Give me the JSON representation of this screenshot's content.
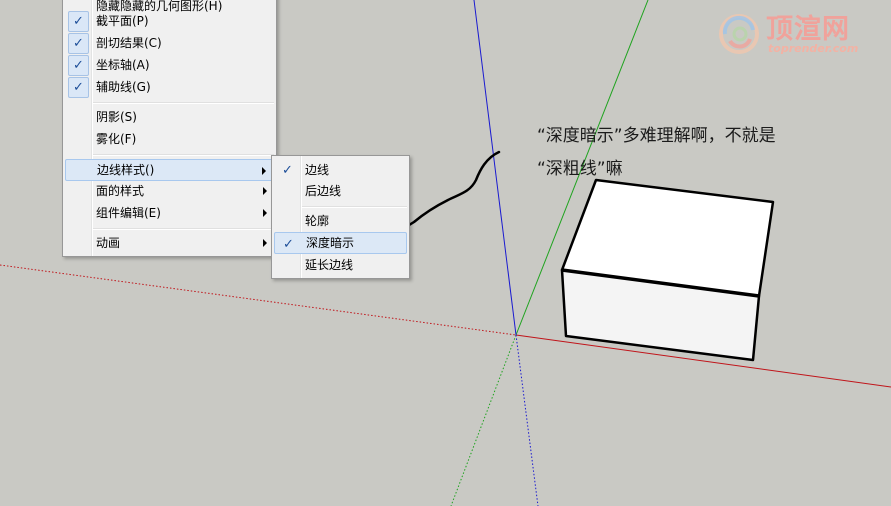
{
  "view_menu": {
    "items": [
      {
        "label": "隐藏隐藏的几何图形(H)",
        "checked": false
      },
      {
        "label": "截平面(P)",
        "checked": true
      },
      {
        "label": "剖切结果(C)",
        "checked": true
      },
      {
        "label": "坐标轴(A)",
        "checked": true
      },
      {
        "label": "辅助线(G)",
        "checked": true
      },
      {
        "label": "阴影(S)",
        "checked": false
      },
      {
        "label": "雾化(F)",
        "checked": false
      },
      {
        "label": "边线样式()",
        "checked": false,
        "submenu": true,
        "highlighted": true
      },
      {
        "label": "面的样式",
        "checked": false,
        "submenu": true
      },
      {
        "label": "组件编辑(E)",
        "checked": false,
        "submenu": true
      },
      {
        "label": "动画",
        "checked": false,
        "submenu": true
      }
    ]
  },
  "edge_style_menu": {
    "items": [
      {
        "label": "边线",
        "checked": true
      },
      {
        "label": "后边线",
        "checked": false
      },
      {
        "label": "轮廓",
        "checked": false
      },
      {
        "label": "深度暗示",
        "checked": true,
        "highlighted": true
      },
      {
        "label": "延长边线",
        "checked": false
      }
    ]
  },
  "check_glyph": "✓",
  "annotation": {
    "line1": "“深度暗示”多难理解啊，不就是",
    "line2": "“深粗线”嘛"
  },
  "watermark": {
    "title": "顶渲网",
    "url": "toprender.com"
  },
  "colors": {
    "background": "#c9c9c4",
    "axis_red": "#c0141a",
    "axis_green": "#1fa31f",
    "axis_blue": "#1a1ad0",
    "menu_highlight": "#dce8f6",
    "watermark": "#f0a29b"
  },
  "icons": {
    "check": "check-icon",
    "submenu": "submenu-arrow-icon",
    "logo": "swirl-logo-icon"
  }
}
